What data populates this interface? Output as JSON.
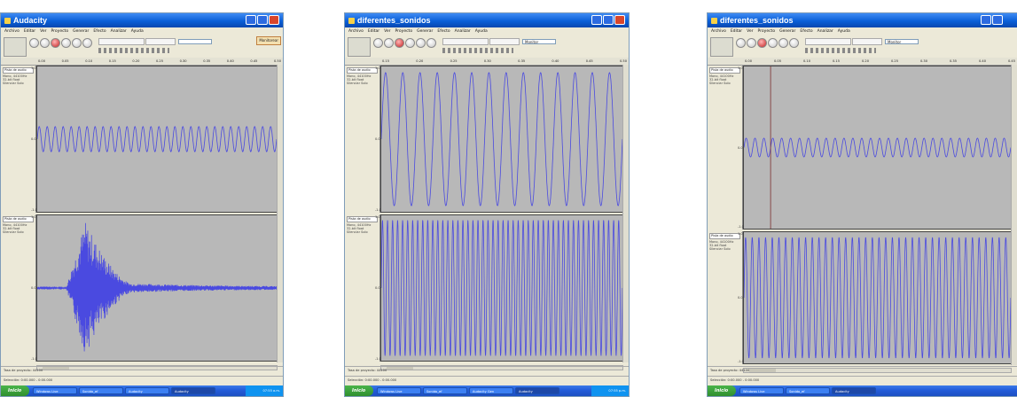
{
  "colors": {
    "waveform": "#4a4ae0",
    "track_bg": "#b8b8b8",
    "titlebar": "#0a5fd8",
    "cursor_line": "#7a2a2a"
  },
  "windows": [
    {
      "title": "Audacity",
      "menu": [
        "Archivo",
        "Editar",
        "Ver",
        "Proyecto",
        "Generar",
        "Efecto",
        "Analizar",
        "Ayuda"
      ],
      "warning_label": "Monitorear",
      "device_select": "",
      "ruler": [
        "0.00",
        "0.05",
        "0.10",
        "0.15",
        "0.20",
        "0.25",
        "0.30",
        "0.35",
        "0.40",
        "0.45",
        "0.50"
      ],
      "tracks": [
        {
          "name": "Pista de audio",
          "info": [
            "Mono, 44100Hz",
            "32-bit float"
          ],
          "mute": "Silenciar",
          "solo": "Solo",
          "scale_top": "1.0",
          "scale_mid": "0.0",
          "scale_bot": "-1.0",
          "wave": {
            "type": "sine",
            "cycles": 30,
            "amplitude": 0.18
          }
        },
        {
          "name": "Pista de audio",
          "info": [
            "Mono, 44100Hz",
            "32-bit float"
          ],
          "mute": "Silenciar",
          "solo": "Solo",
          "scale_top": "1.0",
          "scale_mid": "0.0",
          "scale_bot": "-1.0",
          "wave": {
            "type": "burst",
            "start": 0.12,
            "peak": 0.2,
            "end": 0.4,
            "amplitude": 0.95
          }
        }
      ],
      "status": "Tasa de proyecto: 44100",
      "status2": "Selección: 0:00.000 - 0:00.000",
      "taskbar": [
        "Inicio",
        "Windows Live",
        "Sonido_ef",
        "Audacity",
        "Audacity"
      ],
      "tray_time": "07:55 a.m."
    },
    {
      "title": "diferentes_sonidos",
      "menu": [
        "Archivo",
        "Editar",
        "Ver",
        "Proyecto",
        "Generar",
        "Efecto",
        "Analizar",
        "Ayuda"
      ],
      "warning_label": "",
      "device_select": "Monitor",
      "ruler": [
        "0.15",
        "0.20",
        "0.25",
        "0.30",
        "0.35",
        "0.40",
        "0.45",
        "0.50"
      ],
      "tracks": [
        {
          "name": "Pista de audio",
          "info": [
            "Mono, 44100Hz",
            "32-bit float"
          ],
          "mute": "Silenciar",
          "solo": "Solo",
          "scale_top": "1.0",
          "scale_mid": "0.0",
          "scale_bot": "-1.0",
          "wave": {
            "type": "sine",
            "cycles": 14,
            "amplitude": 0.95
          }
        },
        {
          "name": "Pista de audio",
          "info": [
            "Mono, 44100Hz",
            "32-bit float"
          ],
          "mute": "Silenciar",
          "solo": "Solo",
          "scale_top": "1.0",
          "scale_mid": "0.0",
          "scale_bot": "-1.0",
          "wave": {
            "type": "sine",
            "cycles": 48,
            "amplitude": 0.97
          }
        }
      ],
      "status": "Tasa de proyecto: 44100",
      "status2": "Selección: 0:00.000 - 0:00.000",
      "taskbar": [
        "Inicio",
        "Windows Live",
        "Sonido_ef",
        "Audacity Gen",
        "Audacity"
      ],
      "tray_time": "07:55 p.m."
    },
    {
      "title": "diferentes_sonidos",
      "menu": [
        "Archivo",
        "Editar",
        "Ver",
        "Proyecto",
        "Generar",
        "Efecto",
        "Analizar",
        "Ayuda"
      ],
      "warning_label": "",
      "device_select": "Monitor",
      "ruler": [
        "0.00",
        "0.05",
        "0.10",
        "0.15",
        "0.20",
        "0.25",
        "0.30",
        "0.35",
        "0.40",
        "0.45"
      ],
      "tracks": [
        {
          "name": "Pista de audio",
          "info": [
            "Mono, 44100Hz",
            "32-bit float"
          ],
          "mute": "Silenciar",
          "solo": "Solo",
          "scale_top": "1.0",
          "scale_mid": "0.0",
          "scale_bot": "-1.0",
          "wave": {
            "type": "sine",
            "cycles": 30,
            "amplitude": 0.12,
            "cursor": 0.1
          }
        },
        {
          "name": "Pista de audio",
          "info": [
            "Mono, 44100Hz",
            "32-bit float"
          ],
          "mute": "Silenciar",
          "solo": "Solo",
          "scale_top": "1.0",
          "scale_mid": "0.0",
          "scale_bot": "-1.0",
          "wave": {
            "type": "sine",
            "cycles": 40,
            "amplitude": 0.96
          }
        }
      ],
      "status": "Tasa de proyecto: 44100",
      "status2": "Selección: 0:00.000 - 0:00.000",
      "taskbar": [
        "Inicio",
        "Windows Live",
        "Sonido_ef",
        "Audacity"
      ],
      "tray_time": "07:55 p.m."
    }
  ]
}
